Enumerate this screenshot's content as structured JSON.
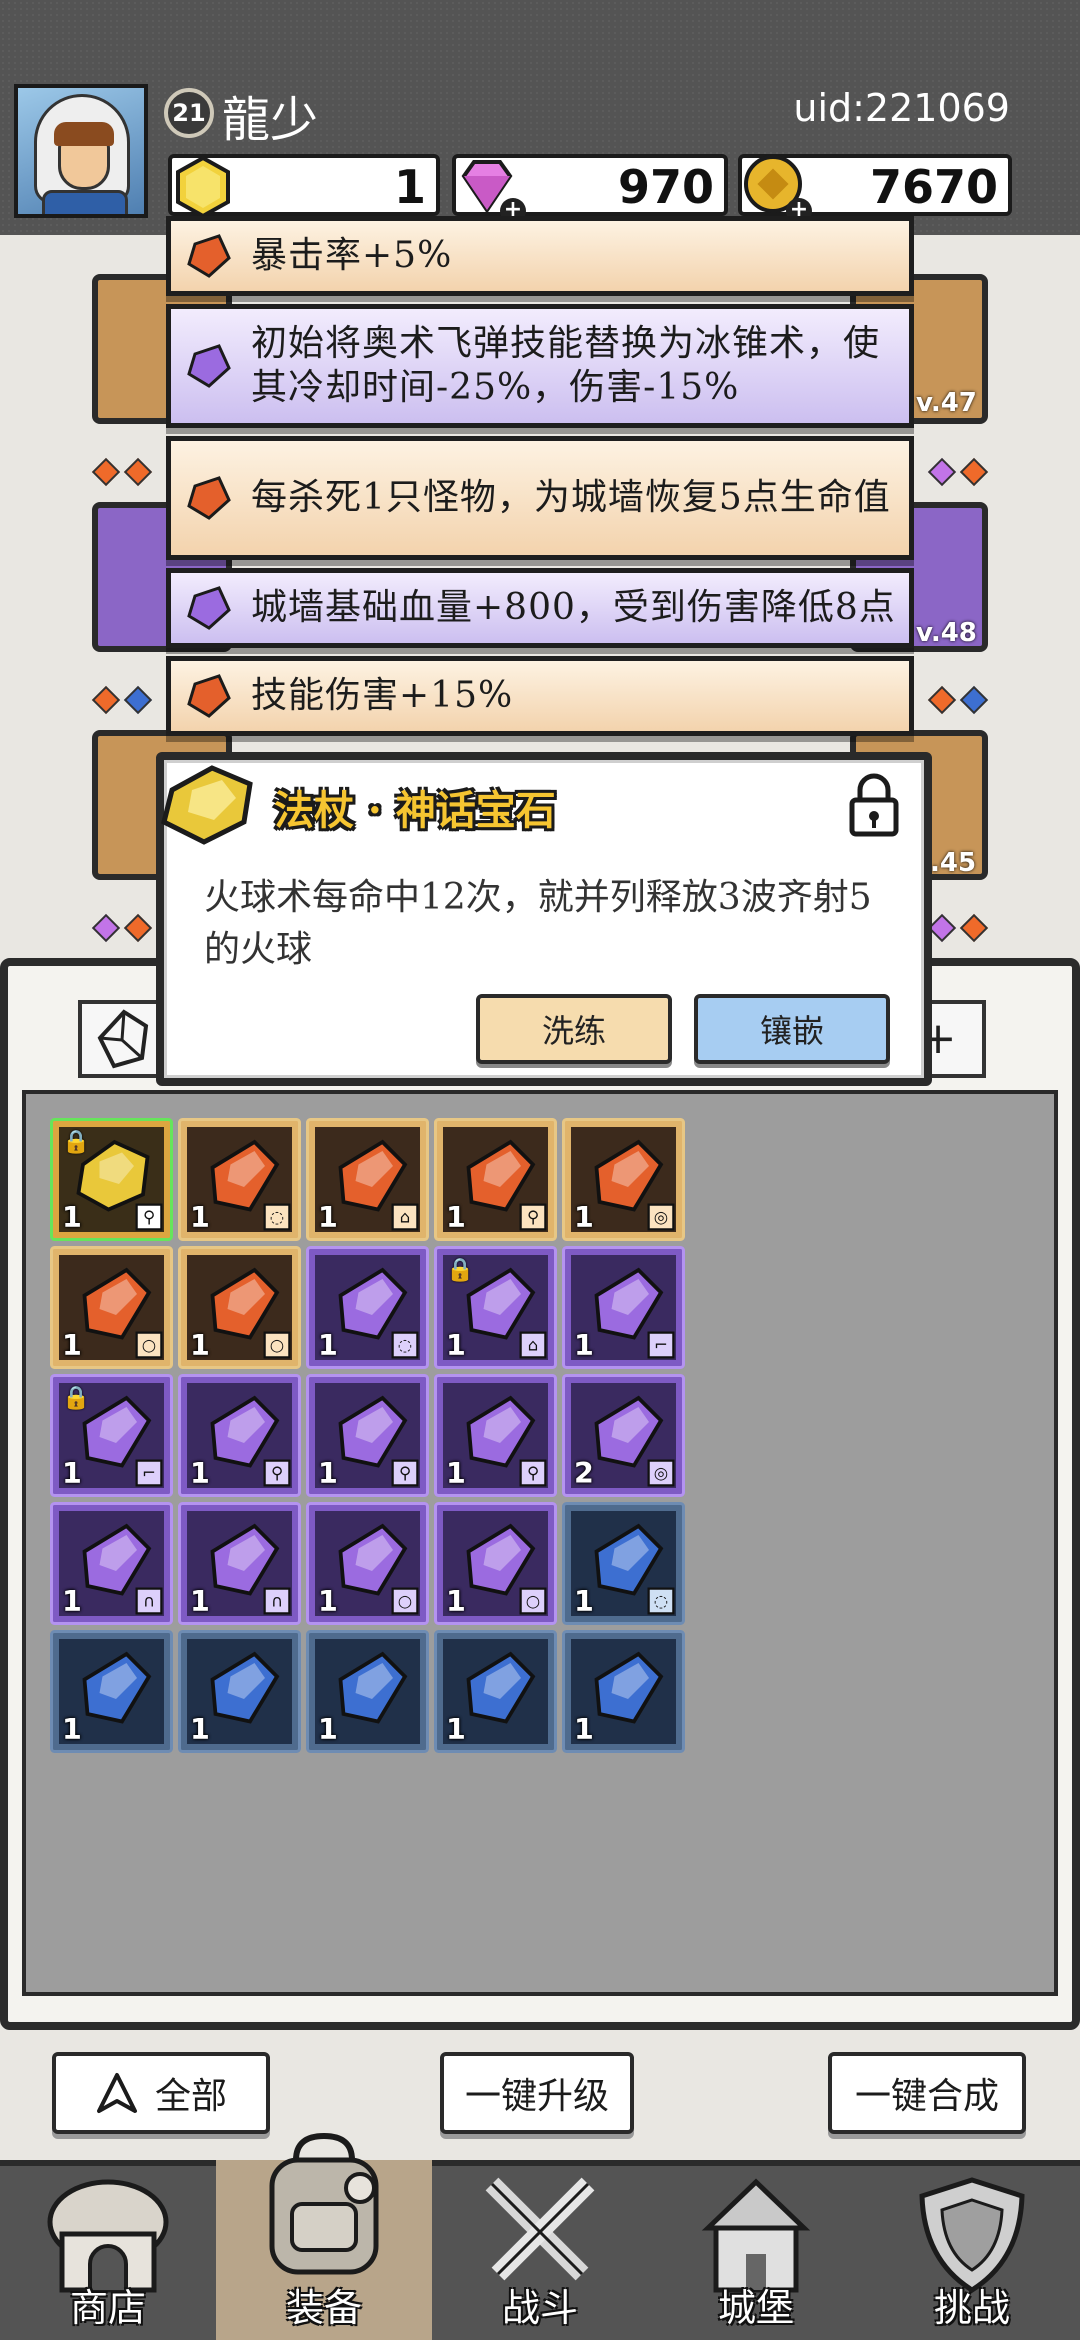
{
  "header": {
    "level": "21",
    "player_name": "龍少",
    "uid": "uid:221069",
    "resources": {
      "gold_gem": "1",
      "diamond": "970",
      "coin": "7670"
    }
  },
  "background_levels": {
    "lv1": "v.47",
    "lv2": "v.48",
    "lv3": ".45"
  },
  "affixes": [
    {
      "color": "orange",
      "text": "暴击率+5%"
    },
    {
      "color": "purple",
      "text": "初始将奥术飞弹技能替换为冰锥术，使其冷却时间-25%，伤害-15%"
    },
    {
      "color": "orange",
      "text": "每杀死1只怪物，为城墙恢复5点生命值"
    },
    {
      "color": "purple",
      "text": "城墙基础血量+800，受到伤害降低8点"
    },
    {
      "color": "orange",
      "text": "技能伤害+15%"
    }
  ],
  "detail": {
    "title": "法杖 · 神话宝石",
    "description": "火球术每命中12次，就并列释放3波齐射5的火球",
    "refine_label": "洗练",
    "inlay_label": "镶嵌"
  },
  "inventory": {
    "plus_label": "+",
    "gems": [
      {
        "color": "gold",
        "count": "1",
        "slot": "staff",
        "locked": true
      },
      {
        "color": "orange",
        "count": "1",
        "slot": "amulet",
        "locked": false
      },
      {
        "color": "orange",
        "count": "1",
        "slot": "armor",
        "locked": false
      },
      {
        "color": "orange",
        "count": "1",
        "slot": "staff",
        "locked": false
      },
      {
        "color": "orange",
        "count": "1",
        "slot": "ring",
        "locked": false
      },
      {
        "color": "orange",
        "count": "1",
        "slot": "necklace",
        "locked": false
      },
      {
        "color": "orange",
        "count": "1",
        "slot": "necklace",
        "locked": false
      },
      {
        "color": "purple",
        "count": "1",
        "slot": "amulet",
        "locked": false
      },
      {
        "color": "purple",
        "count": "1",
        "slot": "armor",
        "locked": true
      },
      {
        "color": "purple",
        "count": "1",
        "slot": "boots",
        "locked": false
      },
      {
        "color": "purple",
        "count": "1",
        "slot": "boots",
        "locked": true
      },
      {
        "color": "purple",
        "count": "1",
        "slot": "staff",
        "locked": false
      },
      {
        "color": "purple",
        "count": "1",
        "slot": "staff",
        "locked": false
      },
      {
        "color": "purple",
        "count": "1",
        "slot": "staff",
        "locked": false
      },
      {
        "color": "purple",
        "count": "2",
        "slot": "ring",
        "locked": false
      },
      {
        "color": "purple",
        "count": "1",
        "slot": "helmet",
        "locked": false
      },
      {
        "color": "purple",
        "count": "1",
        "slot": "helmet",
        "locked": false
      },
      {
        "color": "purple",
        "count": "1",
        "slot": "necklace",
        "locked": false
      },
      {
        "color": "purple",
        "count": "1",
        "slot": "necklace",
        "locked": false
      },
      {
        "color": "blue",
        "count": "1",
        "slot": "amulet",
        "locked": false
      },
      {
        "color": "blue",
        "count": "1",
        "slot": "",
        "locked": false
      },
      {
        "color": "blue",
        "count": "1",
        "slot": "",
        "locked": false
      },
      {
        "color": "blue",
        "count": "1",
        "slot": "",
        "locked": false
      },
      {
        "color": "blue",
        "count": "1",
        "slot": "",
        "locked": false
      },
      {
        "color": "blue",
        "count": "1",
        "slot": "",
        "locked": false
      }
    ]
  },
  "actions": {
    "filter_label": "全部",
    "upgrade_label": "一键升级",
    "merge_label": "一键合成"
  },
  "nav": {
    "shop": "商店",
    "equipment": "装备",
    "battle": "战斗",
    "castle": "城堡",
    "challenge": "挑战"
  },
  "colors": {
    "orange_gem": "#e4602c",
    "purple_gem": "#9b6be0",
    "blue_gem": "#3d6fd1",
    "gold_gem": "#e9c83a",
    "title_gold": "#f6c531"
  }
}
